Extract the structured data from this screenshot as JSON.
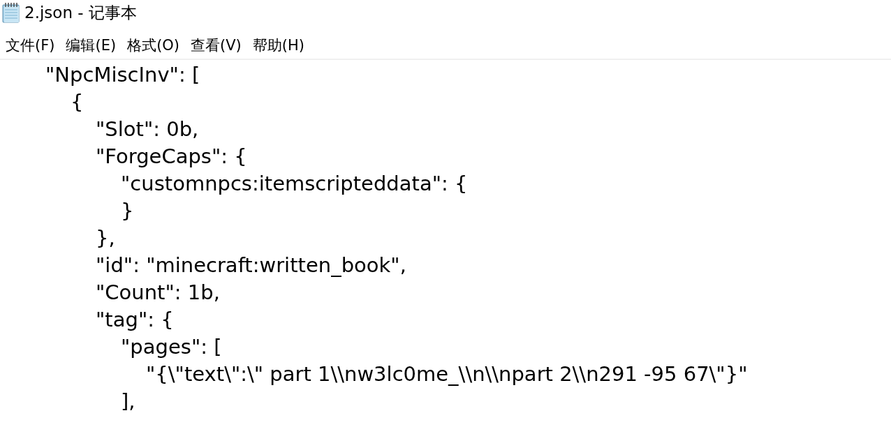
{
  "window": {
    "title": "2.json - 记事本"
  },
  "menu": [
    "文件(F)",
    "编辑(E)",
    "格式(O)",
    "查看(V)",
    "帮助(H)"
  ],
  "editor": {
    "lines": [
      {
        "text": "\"NpcMiscInv\": [",
        "children": [
          {
            "text": "{",
            "children": [
              {
                "text": "\"Slot\": 0b,"
              },
              {
                "text": "\"ForgeCaps\": {",
                "children": [
                  {
                    "text": "\"customnpcs:itemscripteddata\": {"
                  },
                  {
                    "text": "}"
                  }
                ]
              },
              {
                "text": "},"
              },
              {
                "text": "\"id\": \"minecraft:written_book\","
              },
              {
                "text": "\"Count\": 1b,"
              },
              {
                "text": "\"tag\": {",
                "children": [
                  {
                    "text": "\"pages\": [",
                    "children": [
                      {
                        "text": "\"{\\\"text\\\":\\\" part 1\\\\nw3lc0me_\\\\n\\\\npart 2\\\\n291 -95 67\\\"}\""
                      }
                    ]
                  },
                  {
                    "text": "],"
                  }
                ]
              }
            ]
          }
        ]
      }
    ]
  }
}
